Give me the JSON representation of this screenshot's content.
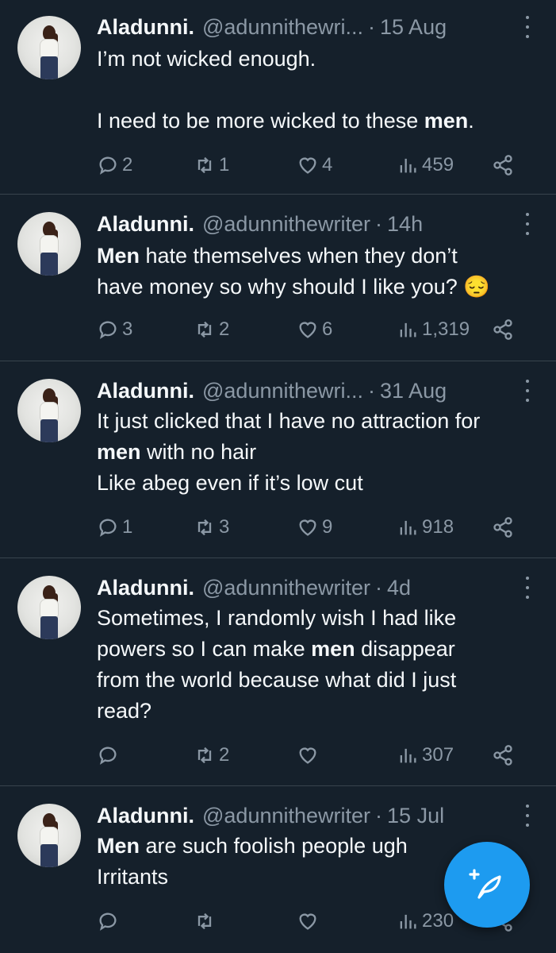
{
  "tweets": [
    {
      "name": "Aladunni.",
      "handle": "@adunnithewri...",
      "time": "15 Aug",
      "lines": [
        [
          {
            "t": "I’m not wicked enough."
          }
        ],
        [],
        [
          {
            "t": "I need to be more wicked to these "
          },
          {
            "t": "men",
            "b": true
          },
          {
            "t": "."
          }
        ]
      ],
      "replies": "2",
      "retweets": "1",
      "likes": "4",
      "views": "459"
    },
    {
      "name": "Aladunni.",
      "handle": "@adunnithewriter",
      "time": "14h",
      "lines": [
        [
          {
            "t": "Men",
            "b": true
          },
          {
            "t": " hate themselves when they don’t"
          }
        ],
        [
          {
            "t": "have money so why should I like you? 😔"
          }
        ]
      ],
      "replies": "3",
      "retweets": "2",
      "likes": "6",
      "views": "1,319"
    },
    {
      "name": "Aladunni.",
      "handle": "@adunnithewri...",
      "time": "31 Aug",
      "lines": [
        [
          {
            "t": "It just clicked that I have no attraction for"
          }
        ],
        [
          {
            "t": "men",
            "b": true
          },
          {
            "t": " with no hair"
          }
        ],
        [
          {
            "t": "Like abeg even if it’s low cut"
          }
        ]
      ],
      "replies": "1",
      "retweets": "3",
      "likes": "9",
      "views": "918"
    },
    {
      "name": "Aladunni.",
      "handle": "@adunnithewriter",
      "time": "4d",
      "lines": [
        [
          {
            "t": "Sometimes, I randomly wish I had like"
          }
        ],
        [
          {
            "t": "powers so I can make "
          },
          {
            "t": "men",
            "b": true
          },
          {
            "t": " disappear"
          }
        ],
        [
          {
            "t": "from the world because what did I just"
          }
        ],
        [
          {
            "t": "read?"
          }
        ]
      ],
      "replies": "",
      "retweets": "2",
      "likes": "",
      "views": "307"
    },
    {
      "name": "Aladunni.",
      "handle": "@adunnithewriter",
      "time": "15 Jul",
      "lines": [
        [
          {
            "t": "Men",
            "b": true
          },
          {
            "t": " are such foolish people ugh"
          }
        ],
        [
          {
            "t": "Irritants"
          }
        ]
      ],
      "replies": "",
      "retweets": "",
      "likes": "",
      "views": "230"
    }
  ],
  "icons": {
    "reply": "reply-icon",
    "retweet": "retweet-icon",
    "like": "heart-icon",
    "views": "views-icon",
    "share": "share-icon",
    "more": "more-dots-icon",
    "compose": "compose-feather-icon"
  },
  "colors": {
    "background": "#15202b",
    "text": "#f5f8fa",
    "muted": "#8b98a5",
    "divider": "#38444d",
    "accent": "#1d9bf0"
  }
}
